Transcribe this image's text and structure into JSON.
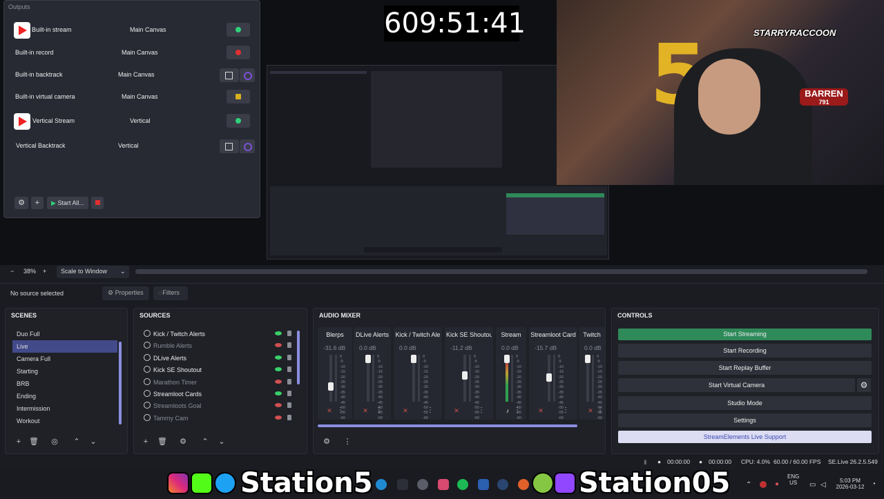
{
  "timer": "609:51:41",
  "outputs": {
    "title": "Outputs",
    "rows": [
      {
        "name": "Built-in stream",
        "canvas": "Main Canvas"
      },
      {
        "name": "Built-in record",
        "canvas": "Main Canvas"
      },
      {
        "name": "Built-in backtrack",
        "canvas": "Main Canvas"
      },
      {
        "name": "Built-in virtual camera",
        "canvas": "Main Canvas"
      },
      {
        "name": "Vertical Stream",
        "canvas": "Vertical"
      },
      {
        "name": "Vertical Backtrack",
        "canvas": "Vertical"
      }
    ],
    "start_all": "Start All...",
    "add_icon": "plus-icon",
    "settings_icon": "gear-icon"
  },
  "webcam": {
    "balloon_text": "5",
    "brand1": "STARRYRACCOON",
    "brand2": "BARREN",
    "brand2_sub": "791"
  },
  "zoom": {
    "minus": "−",
    "value": "38%",
    "plus": "+",
    "scale_mode": "Scale to Window"
  },
  "source_toolbar": {
    "selection": "No source selected",
    "properties": "Properties",
    "filters": "Filters"
  },
  "scenes": {
    "title": "SCENES",
    "items": [
      "Duo Full",
      "Live",
      "Camera Full",
      "Starting",
      "BRB",
      "Ending",
      "Intermission",
      "Workout"
    ],
    "active_index": 1
  },
  "sources": {
    "title": "SOURCES",
    "items": [
      {
        "name": "Kick / Twitch Alerts",
        "visible": true
      },
      {
        "name": "Rumble Alerts",
        "visible": false
      },
      {
        "name": "DLive Alerts",
        "visible": true
      },
      {
        "name": "Kick SE Shoutout",
        "visible": true
      },
      {
        "name": "Marathon Timer",
        "visible": false
      },
      {
        "name": "Streamloot Cards",
        "visible": true
      },
      {
        "name": "Streamloots Goal",
        "visible": false
      },
      {
        "name": "Tammy Cam",
        "visible": false
      }
    ]
  },
  "mixer": {
    "title": "AUDIO MIXER",
    "channels": [
      {
        "name": "Blerps",
        "db": "-31.6 dB",
        "level": 0.33,
        "muted": true
      },
      {
        "name": "DLive Alerts",
        "db": "0.0 dB",
        "level": 1.0,
        "muted": true
      },
      {
        "name": "Kick / Twitch Ale",
        "db": "0.0 dB",
        "level": 1.0,
        "muted": true
      },
      {
        "name": "Kick SE Shoutou",
        "db": "-11.2 dB",
        "level": 0.6,
        "muted": true
      },
      {
        "name": "Stream",
        "db": "0.0 dB",
        "level": 1.0,
        "muted": false
      },
      {
        "name": "Streamloot Card",
        "db": "-15.7 dB",
        "level": 0.55,
        "muted": true
      },
      {
        "name": "Twitch",
        "db": "0.0 dB",
        "level": 1.0,
        "muted": true
      }
    ],
    "scale_marks": [
      "0",
      "-5",
      "-10",
      "-15",
      "-20",
      "-25",
      "-30",
      "-35",
      "-40",
      "-45",
      "-50",
      "-55",
      "-60"
    ]
  },
  "controls": {
    "title": "CONTROLS",
    "start_streaming": "Start Streaming",
    "start_recording": "Start Recording",
    "start_replay": "Start Replay Buffer",
    "start_vcam": "Start Virtual Camera",
    "studio_mode": "Studio Mode",
    "settings": "Settings",
    "support": "StreamElements Live Support"
  },
  "status": {
    "rec_time": "00:00:00",
    "stream_time": "00:00:00",
    "cpu": "CPU: 4.0%",
    "fps": "60.00 / 60.00 FPS",
    "version": "SE.Live 26.2.5.549"
  },
  "taskbar": {
    "handle1": "Station5",
    "handle2": "Station05",
    "lang1": "ENG",
    "lang2": "US",
    "time": "5:03 PM",
    "date": "2026-03-12"
  },
  "colors": {
    "accent": "#424a8a",
    "stream_green": "#2f8a5a",
    "eye_on": "#3ad06a",
    "eye_off": "#d05050"
  }
}
